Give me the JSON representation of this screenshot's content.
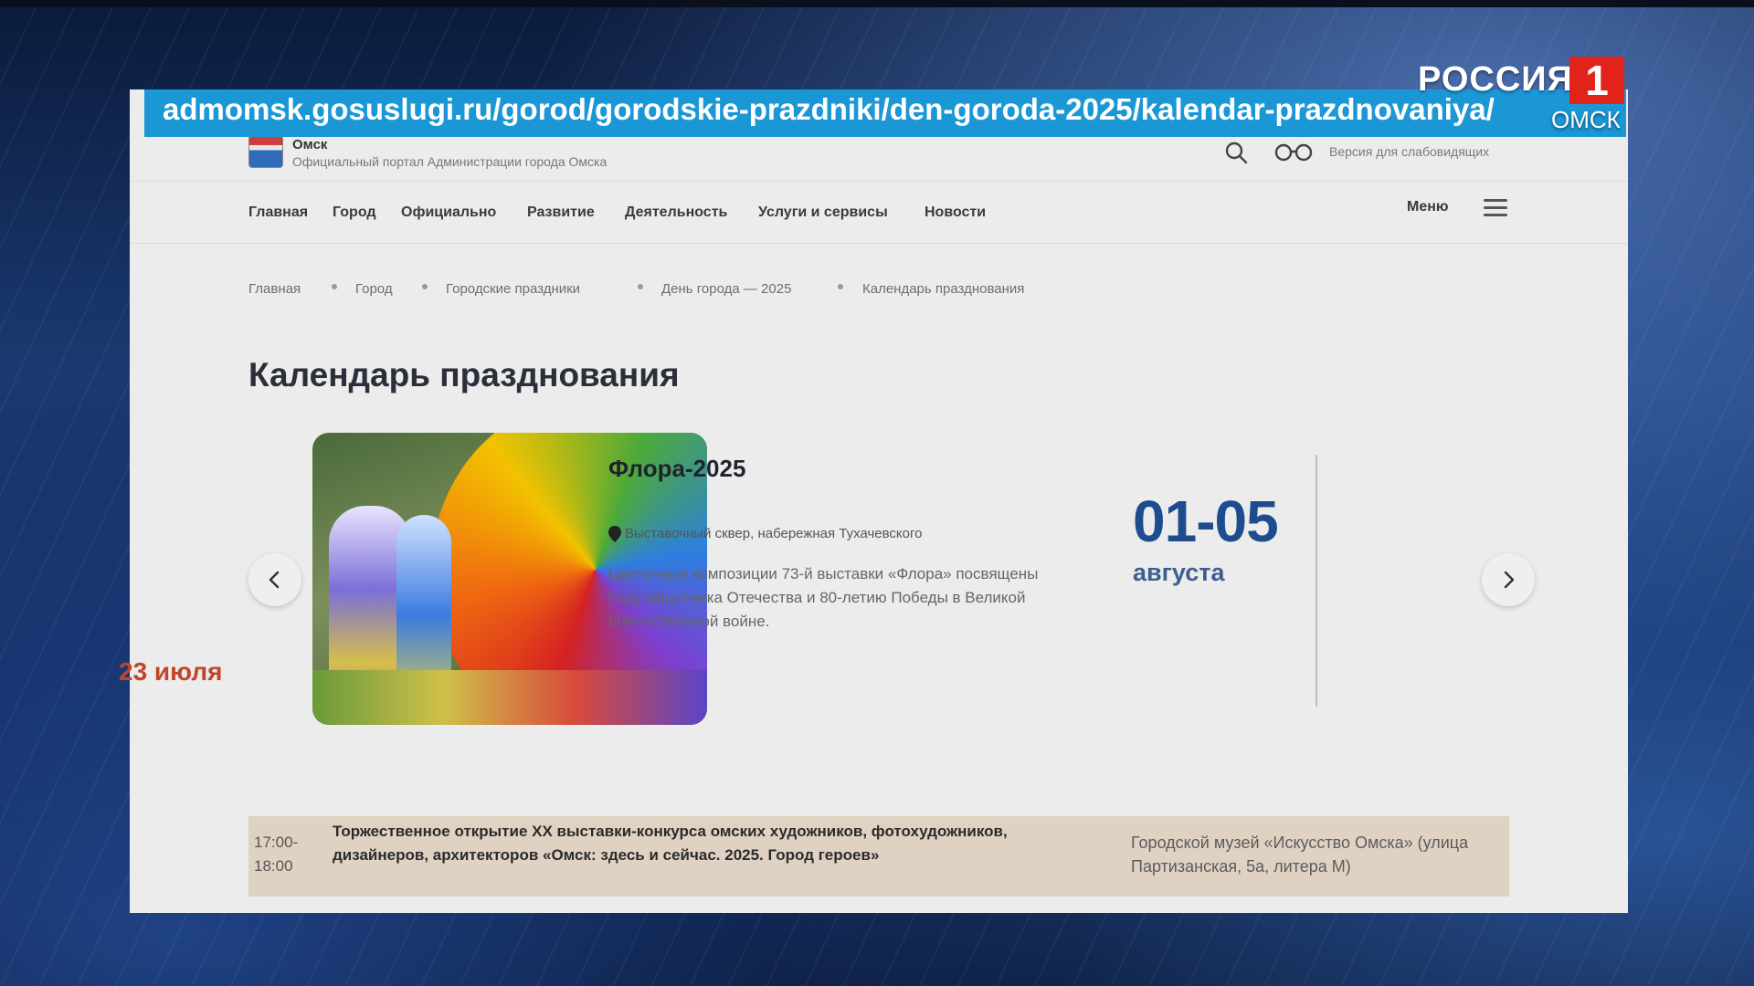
{
  "broadcast": {
    "url": "admomsk.gosuslugi.ru/gorod/gorodskie-prazdniki/den-goroda-2025/kalendar-prazdnovaniya/",
    "channel_name": "РОССИЯ",
    "channel_number": "1",
    "channel_city": "ОМСК"
  },
  "header": {
    "title": "Омск",
    "subtitle": "Официальный портал Администрации города Омска",
    "accessibility_label": "Версия для слабовидящих"
  },
  "nav": {
    "items": [
      "Главная",
      "Город",
      "Официально",
      "Развитие",
      "Деятельность",
      "Услуги и сервисы",
      "Новости"
    ],
    "menu_label": "Меню"
  },
  "breadcrumbs": [
    "Главная",
    "Город",
    "Городские праздники",
    "День города — 2025",
    "Календарь празднования"
  ],
  "page": {
    "title": "Календарь празднования"
  },
  "featured_event": {
    "title": "Флора-2025",
    "location": "Выставочный сквер, набережная Тухачевского",
    "description": "Цветочные композиции 73-й выставки «Флора» посвящены Году защитника Отечества и 80-летию Победы в Великой Отечественной войне.",
    "days": "01-05",
    "month": "августа"
  },
  "schedule": {
    "date": "23 июля",
    "rows": [
      {
        "time": "17:00-18:00",
        "title": "Торжественное открытие XX выставки-конкурса омских художников, фотохудожников, дизайнеров, архитекторов «Омск: здесь и сейчас. 2025. Город героев»",
        "venue": "Городской музей «Искусство Омска» (улица Партизанская, 5а, литера М)"
      }
    ]
  },
  "colors": {
    "accent_blue": "#1d4d8f",
    "date_red": "#c0452b",
    "url_banner": "#1b97d6",
    "row_highlight": "#e0d2c2"
  }
}
